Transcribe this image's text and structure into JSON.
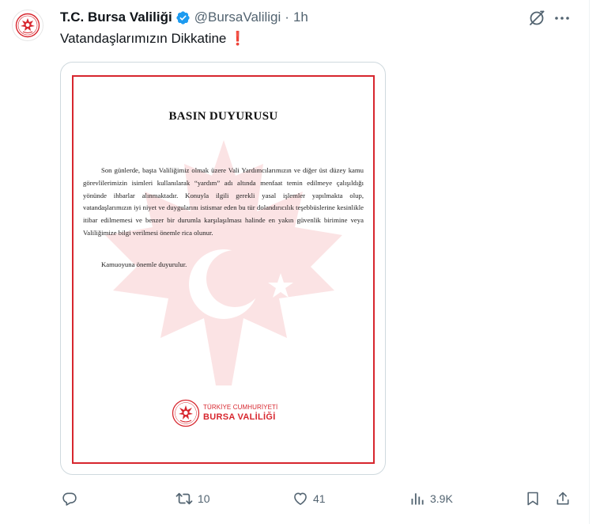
{
  "account": {
    "name": "T.C. Bursa Valiliği",
    "handle": "@BursaValiligi",
    "separator": "·",
    "time": "1h"
  },
  "tweet": {
    "text": "Vatandaşlarımızın Dikkatine",
    "emoji": "❗"
  },
  "document": {
    "title": "BASIN DUYURUSU",
    "body": "Son günlerde, başta Valiliğimiz olmak üzere Vali Yardımcılarımızın ve diğer üst düzey kamu görevlilerimizin isimleri kullanılarak “yardım” adı altında menfaat temin edilmeye çalışıldığı yönünde ihbarlar alınmaktadır. Konuyla ilgili gerekli yasal işlemler yapılmakta olup, vatandaşlarımızın iyi niyet ve duygularını istismar eden bu tür dolandırıcılık teşebbüslerine kesinlikle itibar edilmemesi ve benzer bir durumla karşılaşılması halinde en yakın güvenlik birimine veya Valiliğimize bilgi verilmesi önemle rica olunur.",
    "closing": "Kamuoyuna önemle duyurulur.",
    "footer_line1": "TÜRKİYE CUMHURİYETİ",
    "footer_line2": "BURSA VALİLİĞİ"
  },
  "actions": {
    "reply_count": "",
    "retweet_count": "10",
    "like_count": "41",
    "views_count": "3.9K"
  },
  "colors": {
    "accent_red": "#d7262e",
    "verified_blue": "#1d9bf0",
    "secondary_text": "#536471"
  },
  "icons": [
    "verified-badge-icon",
    "grok-icon",
    "more-icon",
    "reply-icon",
    "retweet-icon",
    "like-icon",
    "views-icon",
    "bookmark-icon",
    "share-icon"
  ]
}
